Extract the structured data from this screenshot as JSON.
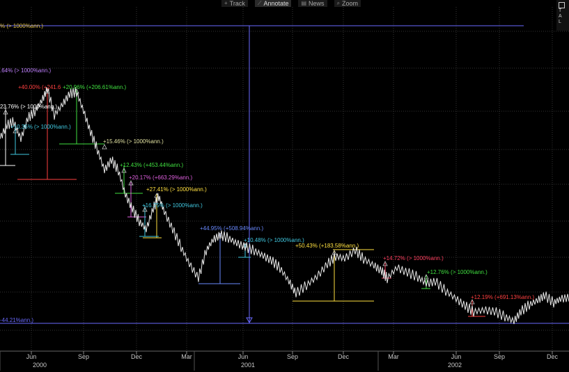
{
  "toolbar": {
    "items": [
      {
        "label": "Track",
        "icon": "crosshair-icon",
        "active": false
      },
      {
        "label": "Annotate",
        "icon": "annotate-icon",
        "active": true
      },
      {
        "label": "News",
        "icon": "news-icon",
        "active": false
      },
      {
        "label": "Zoom",
        "icon": "zoom-icon",
        "active": false
      }
    ]
  },
  "legend": {
    "rows": [
      "T",
      "A",
      "L"
    ]
  },
  "chart_data": {
    "type": "line",
    "x_axis": {
      "months": [
        "Jun",
        "Sep",
        "Dec",
        "Mar",
        "Jun",
        "Sep",
        "Dec",
        "Mar",
        "Jun",
        "Sep",
        "Dec"
      ],
      "years": [
        "2000",
        "2001",
        "2002"
      ]
    },
    "horizontal_lines": [
      {
        "label": "% (> 1000%ann.)",
        "color": "#6a6aff"
      },
      {
        "label": "-44.21%ann.)",
        "color": "#6a6aff"
      }
    ],
    "annotations": [
      {
        "text": ".64% (> 1000%ann.)",
        "color": "#c080ff"
      },
      {
        "text": "+40.00% (+241.6",
        "color": "#ff4040"
      },
      {
        "text": "+20.96% (+206.61%ann.)",
        "color": "#40e040"
      },
      {
        "text": "23.76% (> 1000%ann.)",
        "color": "#ffffff"
      },
      {
        "text": "+10.35% (> 1000%ann.)",
        "color": "#40c8e0"
      },
      {
        "text": "+15.46% (> 1000%ann.)",
        "color": "#e0e0a0"
      },
      {
        "text": "+12.43% (+453.44%ann.)",
        "color": "#40e040"
      },
      {
        "text": "+20.17% (+663.29%ann.)",
        "color": "#e060e0"
      },
      {
        "text": "+27.41% (> 1000%ann.)",
        "color": "#ffe040"
      },
      {
        "text": "+16.75% (> 1000%ann.)",
        "color": "#40c8e0"
      },
      {
        "text": "+44.95% (+508.94%ann.)",
        "color": "#6a8aff"
      },
      {
        "text": "+10.48% (> 1000%ann.)",
        "color": "#40c8e0"
      },
      {
        "text": "+50.43% (+183.58%ann.)",
        "color": "#ffe040"
      },
      {
        "text": "+14.72% (> 1000%ann.)",
        "color": "#ff4060"
      },
      {
        "text": "+12.76% (> 1000%ann.)",
        "color": "#40e040"
      },
      {
        "text": "+12.19% (+691.13%ann.)",
        "color": "#ff4040"
      }
    ],
    "grid": true
  }
}
